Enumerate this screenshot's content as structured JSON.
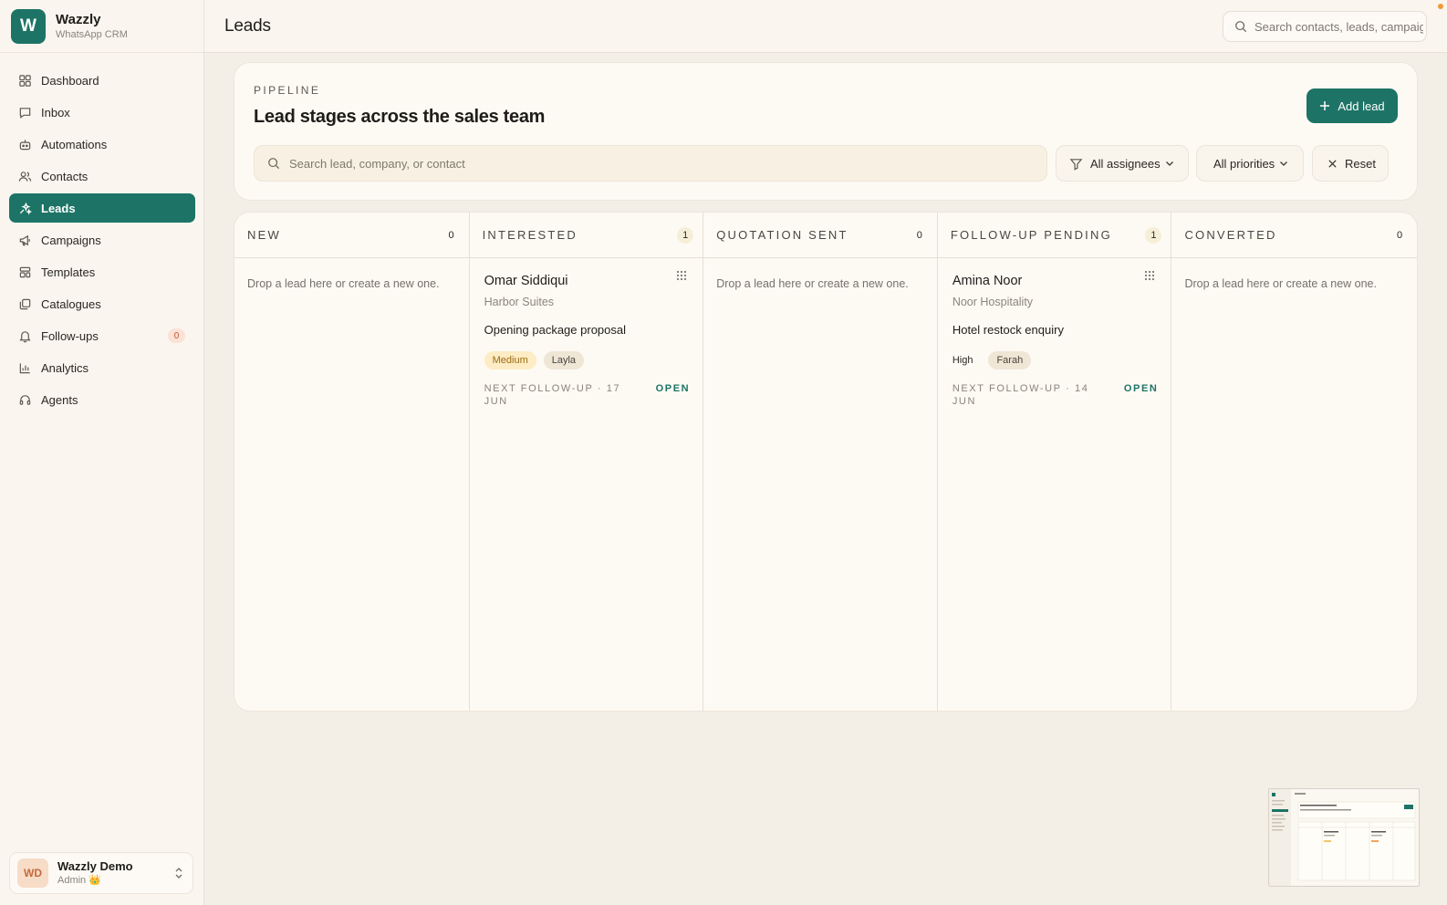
{
  "brand": {
    "name": "Wazzly",
    "subtitle": "WhatsApp CRM",
    "logo_letter": "W",
    "accent": "#1d7466"
  },
  "sidebar": {
    "items": [
      {
        "label": "Dashboard",
        "icon": "grid-icon"
      },
      {
        "label": "Inbox",
        "icon": "message-icon"
      },
      {
        "label": "Automations",
        "icon": "robot-icon"
      },
      {
        "label": "Contacts",
        "icon": "users-icon"
      },
      {
        "label": "Leads",
        "icon": "sparkle-icon",
        "active": true
      },
      {
        "label": "Campaigns",
        "icon": "megaphone-icon"
      },
      {
        "label": "Templates",
        "icon": "layout-icon"
      },
      {
        "label": "Catalogues",
        "icon": "stack-icon"
      },
      {
        "label": "Follow-ups",
        "icon": "bell-icon",
        "badge": "0"
      },
      {
        "label": "Analytics",
        "icon": "bar-chart-icon"
      },
      {
        "label": "Agents",
        "icon": "headset-icon"
      }
    ]
  },
  "user": {
    "initials": "WD",
    "name": "Wazzly Demo",
    "role": "Admin 👑"
  },
  "header": {
    "title": "Leads",
    "search_placeholder": "Search contacts, leads, campaigns"
  },
  "pipeline": {
    "eyebrow": "PIPELINE",
    "title": "Lead stages across the sales team",
    "add_lead_label": "Add lead",
    "search_placeholder": "Search lead, company, or contact",
    "filter_assignees": "All assignees",
    "filter_priorities": "All priorities",
    "reset_label": "Reset"
  },
  "board": {
    "empty_text": "Drop a lead here or create a new one.",
    "columns": [
      {
        "title": "NEW",
        "count": "0"
      },
      {
        "title": "INTERESTED",
        "count": "1"
      },
      {
        "title": "QUOTATION SENT",
        "count": "0"
      },
      {
        "title": "FOLLOW-UP PENDING",
        "count": "1"
      },
      {
        "title": "CONVERTED",
        "count": "0"
      }
    ],
    "leads": [
      {
        "column": "INTERESTED",
        "name": "Omar Siddiqui",
        "company": "Harbor Suites",
        "deal": "Opening package proposal",
        "priority": "Medium",
        "assignee": "Layla",
        "next_followup": "NEXT FOLLOW-UP · 17 JUN",
        "status": "OPEN"
      },
      {
        "column": "FOLLOW-UP PENDING",
        "name": "Amina Noor",
        "company": "Noor Hospitality",
        "deal": "Hotel restock enquiry",
        "priority": "High",
        "assignee": "Farah",
        "next_followup": "NEXT FOLLOW-UP · 14 JUN",
        "status": "OPEN"
      }
    ]
  }
}
